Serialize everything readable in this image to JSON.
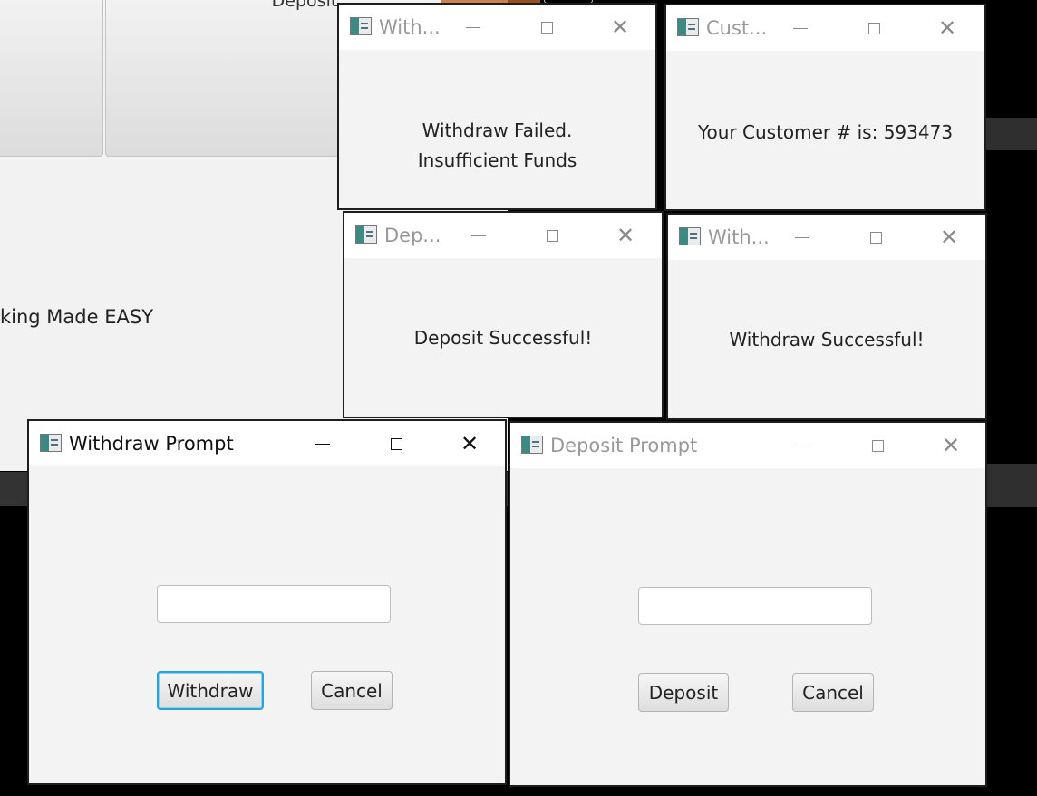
{
  "background": {
    "deposit_label": "Deposit",
    "tagline": "king Made EASY"
  },
  "windows": {
    "withdraw_failed": {
      "title": "With...",
      "line1": "Withdraw Failed.",
      "line2": "Insufficient Funds"
    },
    "customer": {
      "title": "Cust...",
      "message": "Your Customer # is: 593473"
    },
    "deposit_success": {
      "title": "Dep...",
      "message": "Deposit Successful!"
    },
    "withdraw_success": {
      "title": "With...",
      "message": "Withdraw Successful!"
    },
    "withdraw_prompt": {
      "title": "Withdraw Prompt",
      "amount_value": "",
      "primary_label": "Withdraw",
      "cancel_label": "Cancel"
    },
    "deposit_prompt": {
      "title": "Deposit Prompt",
      "amount_value": "",
      "primary_label": "Deposit",
      "cancel_label": "Cancel"
    }
  },
  "icons": {
    "app": "java-app-icon",
    "minimize": "minimize-icon",
    "maximize": "maximize-icon",
    "close": "close-icon"
  },
  "colors": {
    "focus_ring": "#2aa4d8",
    "title_inactive": "#999999",
    "title_active": "#111111"
  }
}
